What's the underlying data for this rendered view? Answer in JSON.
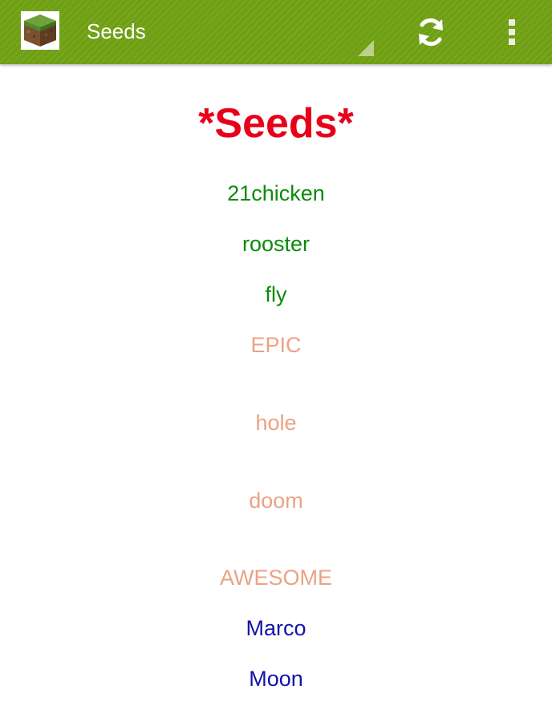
{
  "action_bar": {
    "title": "Seeds",
    "app_icon": "grass-block-icon",
    "refresh_icon": "refresh-icon",
    "overflow_icon": "overflow-menu-icon",
    "color": "#6f9f12"
  },
  "main": {
    "title": "*Seeds*",
    "title_color": "#e8001a",
    "seeds": [
      {
        "label": "21chicken",
        "color": "#0b8a0b"
      },
      {
        "label": "rooster",
        "color": "#0b8a0b"
      },
      {
        "label": "fly",
        "color": "#0b8a0b"
      },
      {
        "label": "EPIC",
        "color": "#eba283"
      },
      {
        "label": "hole",
        "color": "#eba283"
      },
      {
        "label": "doom",
        "color": "#eba283"
      },
      {
        "label": "AWESOME",
        "color": "#eba283"
      },
      {
        "label": "Marco",
        "color": "#1212a8"
      },
      {
        "label": "Moon",
        "color": "#1212a8"
      }
    ]
  }
}
